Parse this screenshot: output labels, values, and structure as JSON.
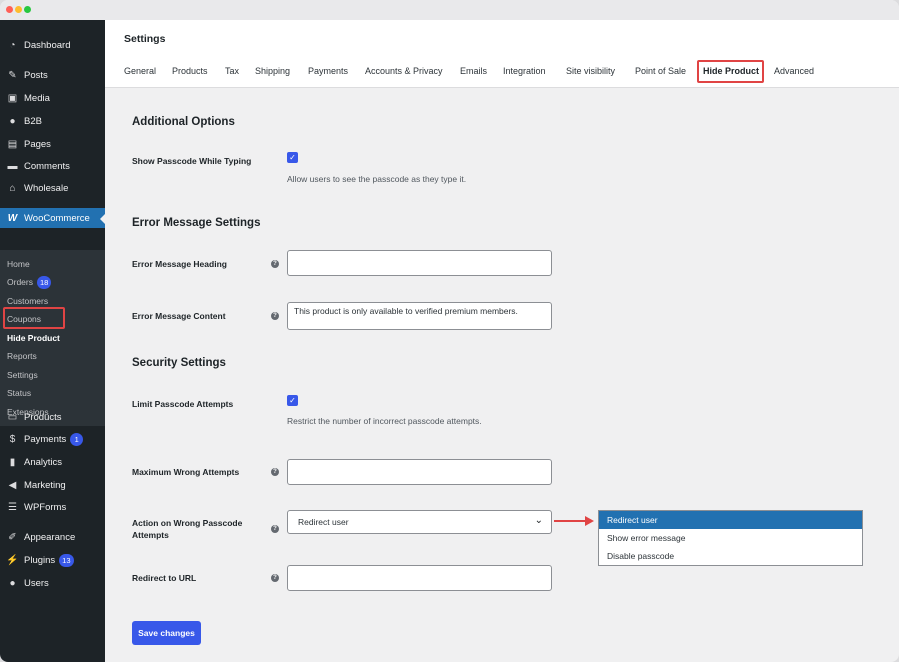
{
  "sidebar": {
    "items": [
      {
        "label": "Dashboard",
        "icon": "dashboard-icon"
      },
      {
        "label": "Posts",
        "icon": "pin-icon"
      },
      {
        "label": "Media",
        "icon": "media-icon"
      },
      {
        "label": "B2B",
        "icon": "group-icon"
      },
      {
        "label": "Pages",
        "icon": "page-icon"
      },
      {
        "label": "Comments",
        "icon": "comment-icon"
      },
      {
        "label": "Wholesale",
        "icon": "store-icon"
      },
      {
        "label": "WooCommerce",
        "icon": "woo-icon"
      },
      {
        "label": "Products",
        "icon": "archive-icon"
      },
      {
        "label": "Payments",
        "icon": "dollar-icon",
        "badge": "1"
      },
      {
        "label": "Analytics",
        "icon": "bar-chart-icon"
      },
      {
        "label": "Marketing",
        "icon": "megaphone-icon"
      },
      {
        "label": "WPForms",
        "icon": "form-icon"
      },
      {
        "label": "Appearance",
        "icon": "brush-icon"
      },
      {
        "label": "Plugins",
        "icon": "plug-icon",
        "badge": "13"
      },
      {
        "label": "Users",
        "icon": "user-icon"
      }
    ],
    "submenu": [
      {
        "label": "Home"
      },
      {
        "label": "Orders",
        "badge": "18"
      },
      {
        "label": "Customers"
      },
      {
        "label": "Coupons"
      },
      {
        "label": "Hide Product"
      },
      {
        "label": "Reports"
      },
      {
        "label": "Settings"
      },
      {
        "label": "Status"
      },
      {
        "label": "Extensions"
      }
    ]
  },
  "header": {
    "title": "Settings",
    "tabs": [
      "General",
      "Products",
      "Tax",
      "Shipping",
      "Payments",
      "Accounts & Privacy",
      "Emails",
      "Integration",
      "Site visibility",
      "Point of Sale",
      "Hide Product",
      "Advanced"
    ],
    "active_tab": "Hide Product"
  },
  "sections": {
    "additional": {
      "heading": "Additional Options",
      "show_passcode_label": "Show Passcode While Typing",
      "show_passcode_checked": true,
      "show_passcode_desc": "Allow users to see the passcode as they type it."
    },
    "error": {
      "heading": "Error Message Settings",
      "heading_label": "Error Message Heading",
      "heading_value": "",
      "content_label": "Error Message Content",
      "content_value": "This product is only available to verified premium members."
    },
    "security": {
      "heading": "Security Settings",
      "limit_label": "Limit Passcode Attempts",
      "limit_checked": true,
      "limit_desc": "Restrict the number of incorrect passcode attempts.",
      "max_label": "Maximum Wrong Attempts",
      "max_value": "",
      "action_label": "Action on Wrong Passcode Attempts",
      "action_value": "Redirect user",
      "action_options": [
        "Redirect user",
        "Show error message",
        "Disable passcode"
      ],
      "redirect_label": "Redirect to URL",
      "redirect_value": ""
    }
  },
  "save_label": "Save changes",
  "help_glyph": "?",
  "colors": {
    "accent": "#3858e9",
    "highlight": "#e04444",
    "sidebar_bg": "#1d2327",
    "selected_option": "#2271b1"
  }
}
